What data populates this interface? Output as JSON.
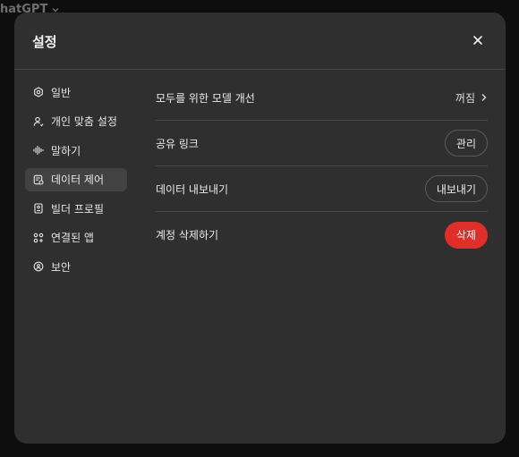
{
  "app": {
    "title": "hatGPT"
  },
  "modal": {
    "title": "설정"
  },
  "sidebar": {
    "items": [
      {
        "label": "일반",
        "icon": "gear-icon"
      },
      {
        "label": "개인 맞춤 설정",
        "icon": "person-icon"
      },
      {
        "label": "말하기",
        "icon": "waveform-icon"
      },
      {
        "label": "데이터 제어",
        "icon": "database-icon",
        "active": true
      },
      {
        "label": "빌더 프로필",
        "icon": "id-card-icon"
      },
      {
        "label": "연결된 앱",
        "icon": "apps-icon"
      },
      {
        "label": "보안",
        "icon": "shield-icon"
      }
    ]
  },
  "data_controls": {
    "improve_model": {
      "label": "모두를 위한 모델 개선",
      "value": "꺼짐"
    },
    "shared_links": {
      "label": "공유 링크",
      "button": "관리"
    },
    "export_data": {
      "label": "데이터 내보내기",
      "button": "내보내기"
    },
    "delete_account": {
      "label": "계정 삭제하기",
      "button": "삭제"
    }
  },
  "colors": {
    "modal_bg": "#2f2f2f",
    "page_bg": "#0e0e0e",
    "danger": "#e02e2a",
    "active_item_bg": "#424242"
  }
}
